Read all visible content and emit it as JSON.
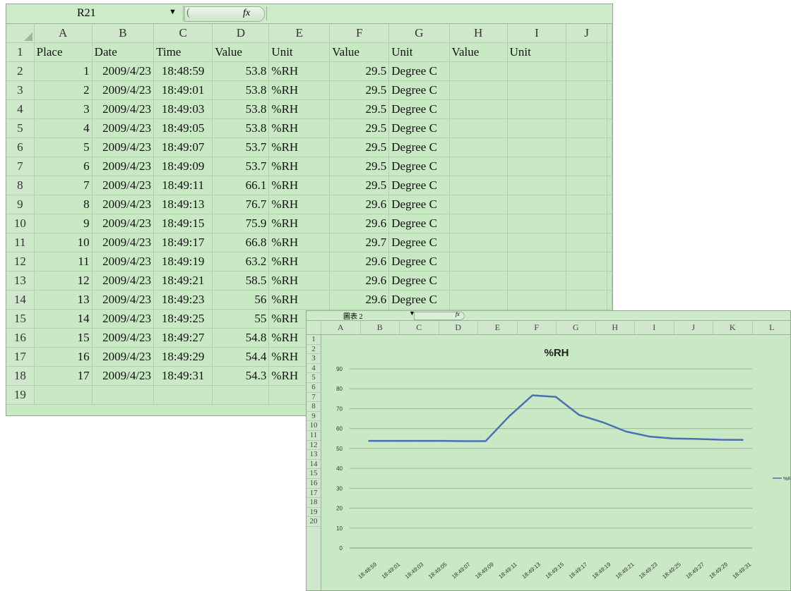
{
  "sheet": {
    "name_box": "R21",
    "fx_label": "fx",
    "columns": [
      "A",
      "B",
      "C",
      "D",
      "E",
      "F",
      "G",
      "H",
      "I",
      "J"
    ],
    "header_row": [
      "Place",
      "Date",
      "Time",
      "Value",
      "Unit",
      "Value",
      "Unit",
      "Value",
      "Unit",
      ""
    ],
    "rows": [
      [
        "1",
        "2009/4/23",
        "18:48:59",
        "53.8",
        "%RH",
        "29.5",
        "Degree C"
      ],
      [
        "2",
        "2009/4/23",
        "18:49:01",
        "53.8",
        "%RH",
        "29.5",
        "Degree C"
      ],
      [
        "3",
        "2009/4/23",
        "18:49:03",
        "53.8",
        "%RH",
        "29.5",
        "Degree C"
      ],
      [
        "4",
        "2009/4/23",
        "18:49:05",
        "53.8",
        "%RH",
        "29.5",
        "Degree C"
      ],
      [
        "5",
        "2009/4/23",
        "18:49:07",
        "53.7",
        "%RH",
        "29.5",
        "Degree C"
      ],
      [
        "6",
        "2009/4/23",
        "18:49:09",
        "53.7",
        "%RH",
        "29.5",
        "Degree C"
      ],
      [
        "7",
        "2009/4/23",
        "18:49:11",
        "66.1",
        "%RH",
        "29.5",
        "Degree C"
      ],
      [
        "8",
        "2009/4/23",
        "18:49:13",
        "76.7",
        "%RH",
        "29.6",
        "Degree C"
      ],
      [
        "9",
        "2009/4/23",
        "18:49:15",
        "75.9",
        "%RH",
        "29.6",
        "Degree C"
      ],
      [
        "10",
        "2009/4/23",
        "18:49:17",
        "66.8",
        "%RH",
        "29.7",
        "Degree C"
      ],
      [
        "11",
        "2009/4/23",
        "18:49:19",
        "63.2",
        "%RH",
        "29.6",
        "Degree C"
      ],
      [
        "12",
        "2009/4/23",
        "18:49:21",
        "58.5",
        "%RH",
        "29.6",
        "Degree C"
      ],
      [
        "13",
        "2009/4/23",
        "18:49:23",
        "56",
        "%RH",
        "29.6",
        "Degree C"
      ],
      [
        "14",
        "2009/4/23",
        "18:49:25",
        "55",
        "%RH",
        "",
        ""
      ],
      [
        "15",
        "2009/4/23",
        "18:49:27",
        "54.8",
        "%RH",
        "",
        ""
      ],
      [
        "16",
        "2009/4/23",
        "18:49:29",
        "54.4",
        "%RH",
        "",
        ""
      ],
      [
        "17",
        "2009/4/23",
        "18:49:31",
        "54.3",
        "%RH",
        "",
        ""
      ]
    ],
    "row_numbers": [
      "1",
      "2",
      "3",
      "4",
      "5",
      "6",
      "7",
      "8",
      "9",
      "10",
      "11",
      "12",
      "13",
      "14",
      "15",
      "16",
      "17",
      "18",
      "19"
    ]
  },
  "chart_sheet": {
    "sheet_name": "圖表 2",
    "fx_label": "fx",
    "columns": [
      "A",
      "B",
      "C",
      "D",
      "E",
      "F",
      "G",
      "H",
      "I",
      "J",
      "K",
      "L"
    ],
    "row_numbers": [
      "1",
      "2",
      "3",
      "4",
      "5",
      "6",
      "7",
      "8",
      "9",
      "10",
      "11",
      "12",
      "13",
      "14",
      "15",
      "16",
      "17",
      "18",
      "19",
      "20"
    ]
  },
  "chart_data": {
    "type": "line",
    "title": "%RH",
    "x": [
      "18:48:59",
      "18:49:01",
      "18:49:03",
      "18:49:05",
      "18:49:07",
      "18:49:09",
      "18:49:11",
      "18:49:13",
      "18:49:15",
      "18:49:17",
      "18:49:19",
      "18:49:21",
      "18:49:23",
      "18:49:25",
      "18:49:27",
      "18:49:29",
      "18:49:31"
    ],
    "series": [
      {
        "name": "%RH",
        "values": [
          53.8,
          53.8,
          53.8,
          53.8,
          53.7,
          53.7,
          66.1,
          76.7,
          75.9,
          66.8,
          63.2,
          58.5,
          56,
          55,
          54.8,
          54.4,
          54.3
        ],
        "color": "#4a6fb5"
      }
    ],
    "ylim": [
      0,
      90
    ],
    "yticks": [
      0,
      10,
      20,
      30,
      40,
      50,
      60,
      70,
      80,
      90
    ],
    "grid": true,
    "legend": "right"
  },
  "colors": {
    "background": "#c9e8c4",
    "header": "#cfe7cb",
    "gridline": "#b3cfb0",
    "series": "#4a6fb5"
  }
}
